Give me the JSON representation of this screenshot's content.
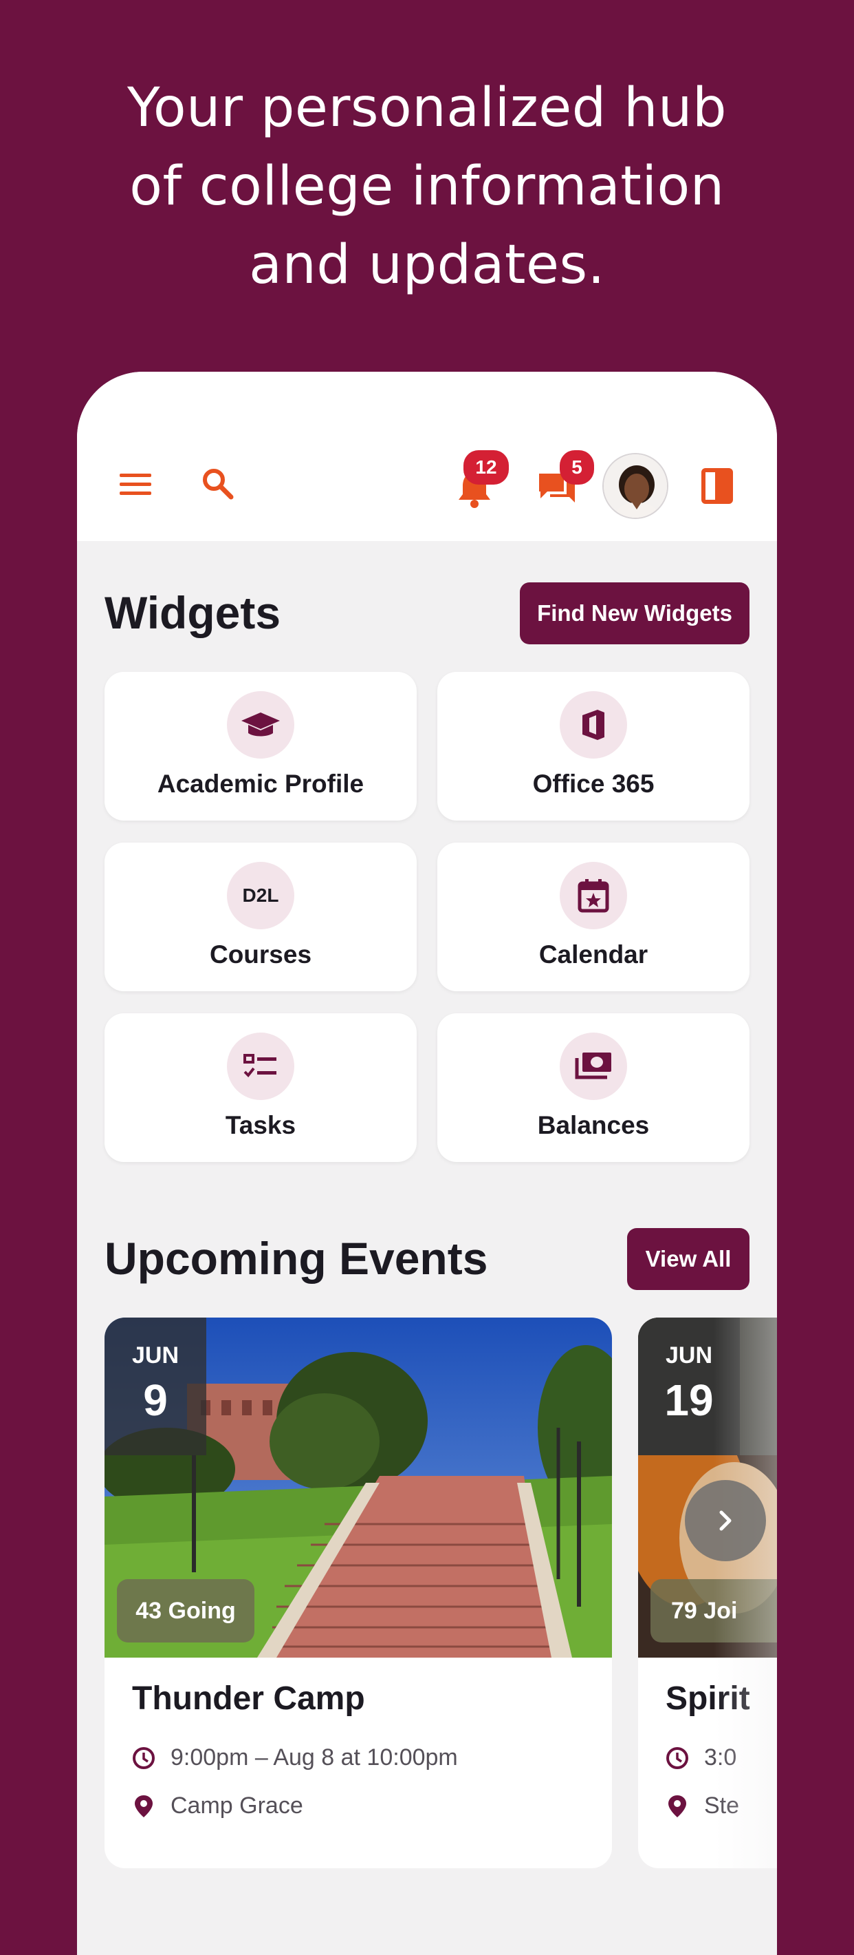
{
  "headline": {
    "line1": "Your personalized hub",
    "line2": "of college information",
    "line3": "and updates."
  },
  "topbar": {
    "notifications_count": "12",
    "messages_count": "5"
  },
  "widgets": {
    "title": "Widgets",
    "find_button": "Find New Widgets",
    "items": [
      {
        "label": "Academic Profile",
        "icon": "graduation-cap-icon"
      },
      {
        "label": "Office 365",
        "icon": "office-icon"
      },
      {
        "label": "Courses",
        "icon": "d2l-icon",
        "icon_text": "D2L"
      },
      {
        "label": "Calendar",
        "icon": "calendar-star-icon"
      },
      {
        "label": "Tasks",
        "icon": "tasks-icon"
      },
      {
        "label": "Balances",
        "icon": "money-icon"
      }
    ]
  },
  "events": {
    "title": "Upcoming Events",
    "view_all": "View All",
    "items": [
      {
        "month": "JUN",
        "day": "9",
        "going": "43 Going",
        "title": "Thunder Camp",
        "time": "9:00pm – Aug 8 at 10:00pm",
        "location": "Camp Grace"
      },
      {
        "month": "JUN",
        "day": "19",
        "going": "79 Joi",
        "title": "Spirit",
        "time": "3:0",
        "location": "Ste"
      }
    ]
  },
  "colors": {
    "brand": "#6c1240",
    "accent": "#e8511f",
    "badge": "#d42034"
  }
}
